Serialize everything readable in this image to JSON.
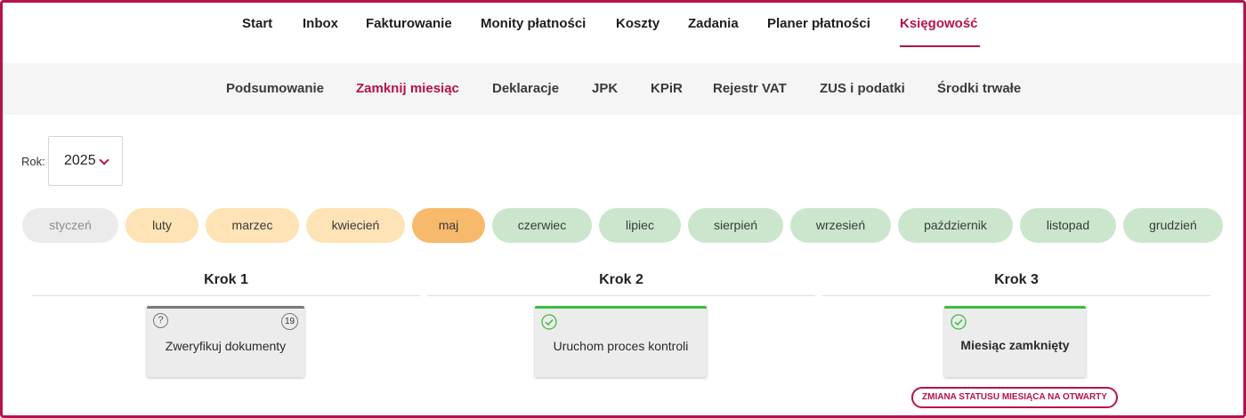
{
  "topnav": {
    "items": [
      {
        "label": "Start"
      },
      {
        "label": "Inbox"
      },
      {
        "label": "Fakturowanie"
      },
      {
        "label": "Monity płatności"
      },
      {
        "label": "Koszty"
      },
      {
        "label": "Zadania"
      },
      {
        "label": "Planer płatności"
      },
      {
        "label": "Księgowość",
        "active": true
      }
    ]
  },
  "subnav": {
    "items": [
      {
        "label": "Podsumowanie"
      },
      {
        "label": "Zamknij miesiąc",
        "active": true
      },
      {
        "label": "Deklaracje"
      },
      {
        "label": "JPK"
      },
      {
        "label": "KPiR"
      },
      {
        "label": "Rejestr VAT"
      },
      {
        "label": "ZUS i podatki"
      },
      {
        "label": "Środki trwałe"
      }
    ]
  },
  "year": {
    "label": "Rok:",
    "value": "2025"
  },
  "months": [
    {
      "label": "styczeń",
      "status": "grey"
    },
    {
      "label": "luty",
      "status": "light"
    },
    {
      "label": "marzec",
      "status": "light"
    },
    {
      "label": "kwiecień",
      "status": "light"
    },
    {
      "label": "maj",
      "status": "orange"
    },
    {
      "label": "czerwiec",
      "status": "green"
    },
    {
      "label": "lipiec",
      "status": "green"
    },
    {
      "label": "sierpień",
      "status": "green"
    },
    {
      "label": "wrzesień",
      "status": "green"
    },
    {
      "label": "październik",
      "status": "green"
    },
    {
      "label": "listopad",
      "status": "green"
    },
    {
      "label": "grudzień",
      "status": "green"
    }
  ],
  "steps": [
    {
      "title": "Krok 1",
      "card": {
        "text": "Zweryfikuj dokumenty",
        "badge": "19",
        "help_icon": "?"
      }
    },
    {
      "title": "Krok 2",
      "card": {
        "text": "Uruchom proces kontroli"
      }
    },
    {
      "title": "Krok 3",
      "card": {
        "text": "Miesiąc zamknięty"
      }
    }
  ],
  "status_button": {
    "label": "ZMIANA STATUSU MIESIĄCA NA OTWARTY"
  },
  "colors": {
    "accent": "#b5124e",
    "success": "#3bbd3f",
    "month_orange": "#f7b96b",
    "month_light": "#fde3b5",
    "month_green": "#cce6ce",
    "month_grey": "#ebebeb"
  }
}
